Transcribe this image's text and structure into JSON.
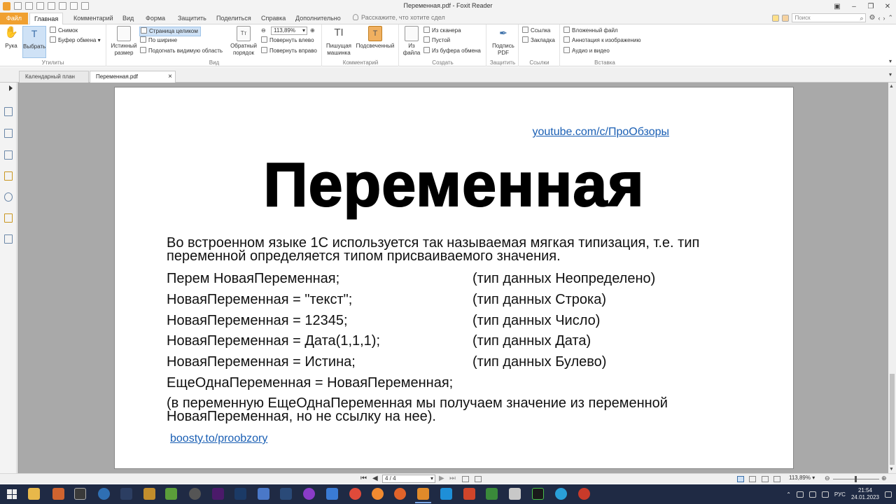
{
  "window": {
    "title": "Переменная.pdf - Foxit Reader"
  },
  "menu": {
    "file": "Файл",
    "tabs": [
      "Главная",
      "Комментарий",
      "Вид",
      "Форма",
      "Защитить",
      "Поделиться",
      "Справка",
      "Дополнительно"
    ],
    "active_tab": "Главная",
    "tell_me": "Расскажите, что хотите сдел",
    "search_placeholder": "Поиск"
  },
  "ribbon": {
    "hand": "Рука",
    "select": "Выбрать",
    "snapshot": "Снимок",
    "clipboard": "Буфер обмена",
    "group_utils": "Утилиты",
    "actual_size": [
      "Истинный",
      "размер"
    ],
    "fit_page": "Страница целиком",
    "fit_width": "По ширине",
    "fit_visible": "Подогнать видимую область",
    "reverse_order": [
      "Обратный",
      "порядок"
    ],
    "zoom_value": "113,89%",
    "rotate_left": "Повернуть влево",
    "rotate_right": "Повернуть вправо",
    "group_view": "Вид",
    "typewriter": [
      "Пишущая",
      "машинка"
    ],
    "highlight": "Подсвеченный",
    "group_comment": "Комментарий",
    "from_file": [
      "Из",
      "файла"
    ],
    "from_scanner": "Из сканера",
    "blank": "Пустой",
    "from_clipboard": "Из буфера обмена",
    "group_create": "Создать",
    "sign_pdf": [
      "Подпись",
      "PDF"
    ],
    "group_protect": "Защитить",
    "link": "Ссылка",
    "bookmark": "Закладка",
    "group_links": "Ссылки",
    "embedded_file": "Вложенный файл",
    "image_annotation": "Аннотация к изображению",
    "audio_video": "Аудио и видео",
    "group_insert": "Вставка"
  },
  "doc_tabs": [
    {
      "label": "Календарный план м..."
    },
    {
      "label": "Переменная.pdf"
    }
  ],
  "page": {
    "youtube_link": "youtube.com/c/ПроОбзоры",
    "title": "Переменная",
    "intro": "Во встроенном языке 1С используется так называемая мягкая типизация, т.е. тип переменной определяется типом присваиваемого значения.",
    "rows": [
      {
        "code": "Перем НоваяПеременная;",
        "note": "(тип данных Неопределено)"
      },
      {
        "code": "НоваяПеременная = \"текст\";",
        "note": "(тип данных Строка)"
      },
      {
        "code": "НоваяПеременная = 12345;",
        "note": "(тип данных Число)"
      },
      {
        "code": "НоваяПеременная = Дата(1,1,1);",
        "note": "(тип данных Дата)"
      },
      {
        "code": "НоваяПеременная = Истина;",
        "note": "(тип данных Булево)"
      },
      {
        "code": "ЕщеОднаПеременная = НоваяПеременная;",
        "note": ""
      }
    ],
    "outro": "(в переменную ЕщеОднаПеременная мы получаем значение из переменной НоваяПеременная, но не ссылку на нее).",
    "boosty_link": "boosty.to/proobzory"
  },
  "statusbar": {
    "page_indicator": "4 / 4",
    "zoom": "113,89%"
  },
  "taskbar": {
    "language": "РУС",
    "time": "21:54",
    "date": "24.01.2023"
  }
}
